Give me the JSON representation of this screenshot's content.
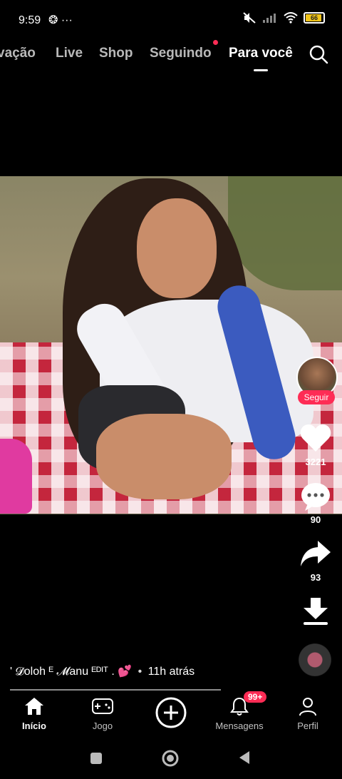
{
  "status": {
    "time": "9:59",
    "left_icons": "❂ ···",
    "battery": "66"
  },
  "topnav": {
    "tabs": [
      {
        "label": "vação"
      },
      {
        "label": "Live"
      },
      {
        "label": "Shop"
      },
      {
        "label": "Seguindo"
      },
      {
        "label": "Para você"
      }
    ],
    "active_tab": "Para você"
  },
  "side": {
    "follow_label": "Seguir",
    "likes": "3221",
    "comments": "90",
    "shares": "93"
  },
  "caption": {
    "author": "' 𝓓oloh ᴱ 𝓜anu ᴱᴰᴵᵀ . 💕",
    "dot": "•",
    "time_ago": "11h atrás"
  },
  "bottomnav": {
    "home": "Início",
    "games": "Jogo",
    "messages": "Mensagens",
    "profile": "Perfil",
    "badge": "99+"
  },
  "colors": {
    "accent": "#fe2c55",
    "battery": "#f0c419"
  },
  "icons": [
    "alarm-icon",
    "more-icon",
    "mute-icon",
    "signal-icon",
    "wifi-icon",
    "battery-icon",
    "search-icon",
    "heart-icon",
    "comment-icon",
    "share-icon",
    "download-icon",
    "music-disc-icon",
    "home-icon",
    "gamepad-icon",
    "plus-icon",
    "bell-icon",
    "person-icon",
    "square-nav-icon",
    "circle-nav-icon",
    "triangle-nav-icon"
  ]
}
